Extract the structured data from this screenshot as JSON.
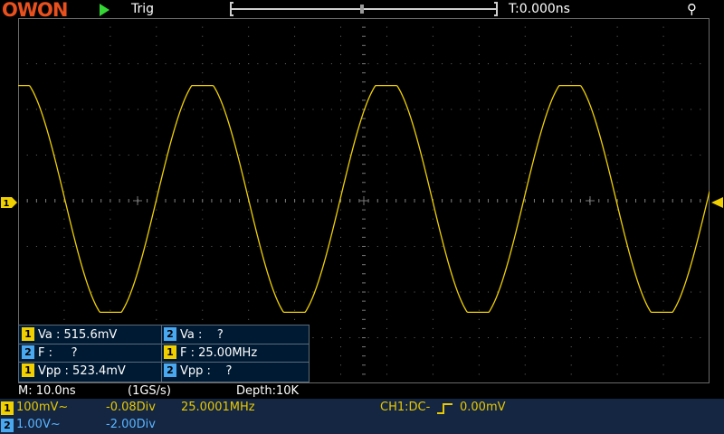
{
  "header": {
    "brand": "OWON",
    "trigger_label": "Trig",
    "time_position": "T:0.000ns",
    "trigger_marker": "T"
  },
  "channel_markers": {
    "ch1_left": "1",
    "ch1_right": ""
  },
  "measurements": [
    {
      "channel": "1",
      "text": "Va : 515.6mV"
    },
    {
      "channel": "2",
      "text": "Va :    ?"
    },
    {
      "channel": "2",
      "text": "F :     ?"
    },
    {
      "channel": "1",
      "text": "F : 25.00MHz"
    },
    {
      "channel": "1",
      "text": "Vpp : 523.4mV"
    },
    {
      "channel": "2",
      "text": "Vpp :    ?"
    }
  ],
  "status": {
    "timebase": "M: 10.0ns",
    "sample_rate": "(1GS/s)",
    "depth": "Depth:10K"
  },
  "channels": {
    "ch1": {
      "label": "1",
      "scale": "100mV~",
      "offset": "-0.08Div",
      "frequency": "25.0001MHz",
      "trigger": "CH1:DC-",
      "trigger_level": "0.00mV"
    },
    "ch2": {
      "label": "2",
      "scale": "1.00V~",
      "offset": "-2.00Div"
    }
  },
  "colors": {
    "ch1": "#f0d000",
    "ch2": "#4aa8f0",
    "grid": "#5a5a5a",
    "background": "#000000",
    "brand": "#e8501e"
  }
}
